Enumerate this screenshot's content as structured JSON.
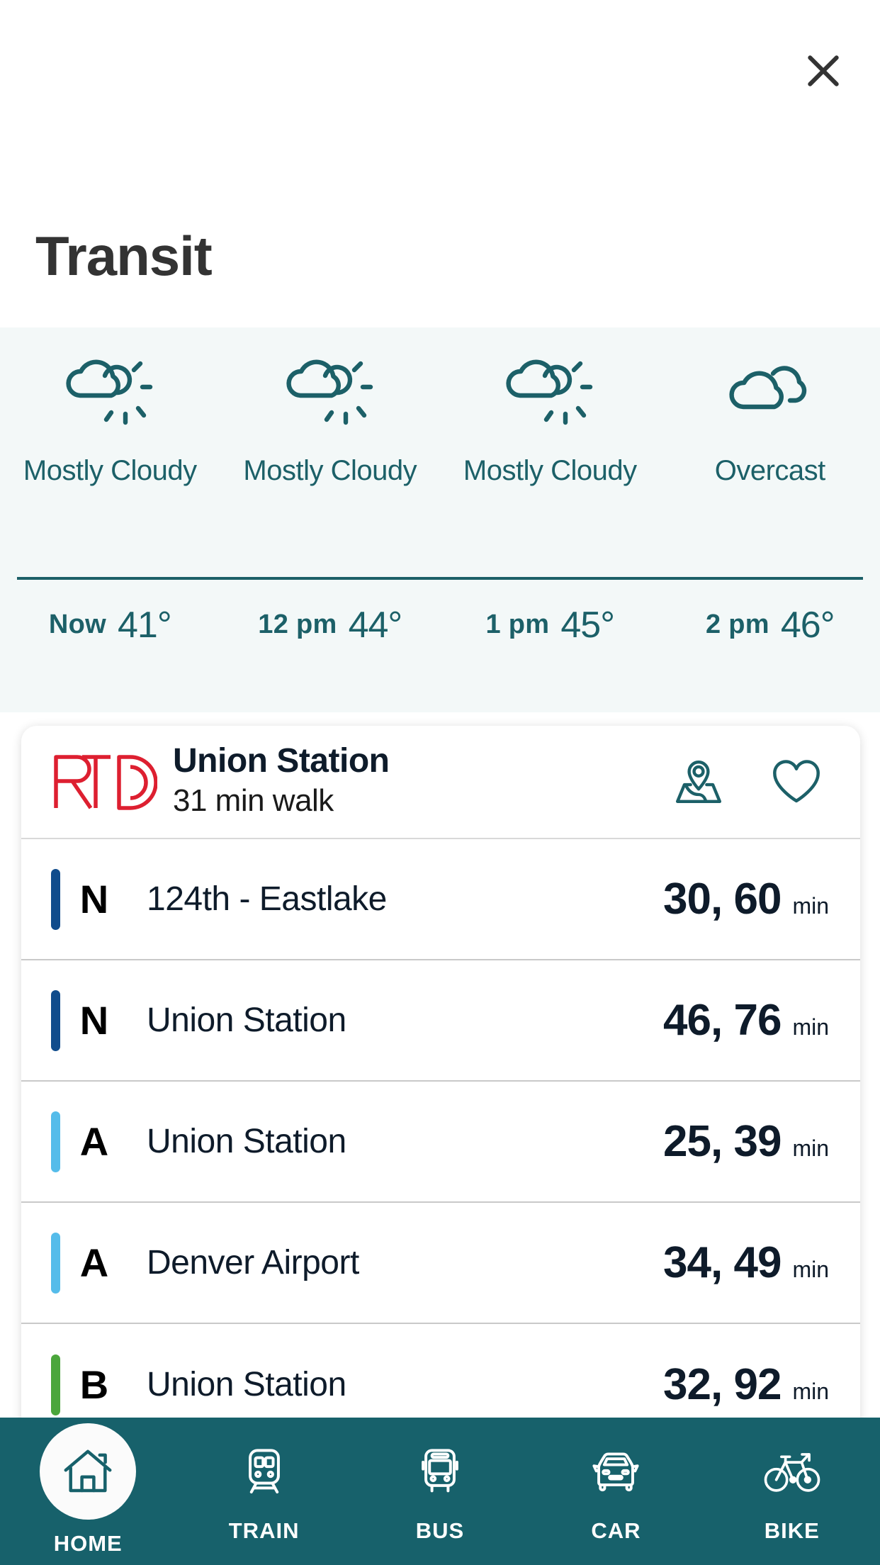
{
  "header": {
    "title": "Transit",
    "close_icon": "close-icon"
  },
  "weather": {
    "forecast": [
      {
        "icon": "partly-cloudy-sun-icon",
        "condition": "Mostly Cloudy",
        "time": "Now",
        "temp": "41°"
      },
      {
        "icon": "partly-cloudy-sun-icon",
        "condition": "Mostly Cloudy",
        "time": "12 pm",
        "temp": "44°"
      },
      {
        "icon": "partly-cloudy-sun-icon",
        "condition": "Mostly Cloudy",
        "time": "1 pm",
        "temp": "45°"
      },
      {
        "icon": "overcast-clouds-icon",
        "condition": "Overcast",
        "time": "2 pm",
        "temp": "46°"
      }
    ],
    "accent_color": "#1c6068",
    "background_color": "#f3f8f8"
  },
  "station_card": {
    "agency_logo": "rtd-logo",
    "agency_name": "RTD",
    "name": "Union Station",
    "walk_time": "31 min walk",
    "map_icon": "map-pin-icon",
    "favorite_icon": "heart-icon",
    "routes": [
      {
        "line": "N",
        "color": "#104c8c",
        "destination": "124th - Eastlake",
        "times": "30, 60",
        "unit": "min"
      },
      {
        "line": "N",
        "color": "#104c8c",
        "destination": "Union Station",
        "times": "46, 76",
        "unit": "min"
      },
      {
        "line": "A",
        "color": "#55bcea",
        "destination": "Union Station",
        "times": "25, 39",
        "unit": "min"
      },
      {
        "line": "A",
        "color": "#55bcea",
        "destination": "Denver Airport",
        "times": "34, 49",
        "unit": "min"
      },
      {
        "line": "B",
        "color": "#4ba63c",
        "destination": "Union Station",
        "times": "32, 92",
        "unit": "min"
      }
    ]
  },
  "bottom_nav": {
    "background_color": "#17616b",
    "items": [
      {
        "label": "HOME",
        "icon": "home-icon",
        "active": true
      },
      {
        "label": "TRAIN",
        "icon": "train-icon",
        "active": false
      },
      {
        "label": "BUS",
        "icon": "bus-icon",
        "active": false
      },
      {
        "label": "CAR",
        "icon": "car-icon",
        "active": false
      },
      {
        "label": "BIKE",
        "icon": "bicycle-icon",
        "active": false
      }
    ]
  }
}
